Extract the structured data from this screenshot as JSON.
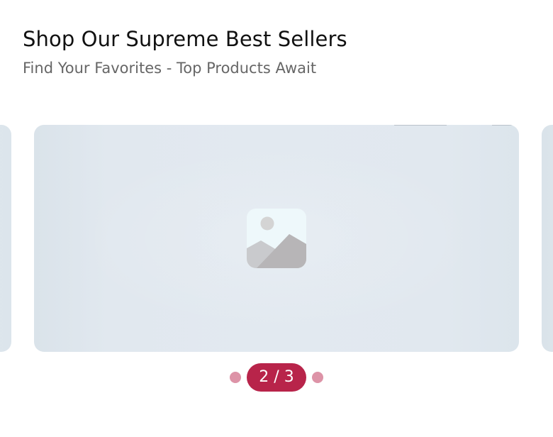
{
  "section": {
    "title": "Shop Our Supreme Best Sellers",
    "subtitle": "Find Your Favorites - Top Products Await"
  },
  "carousel": {
    "current_slide": 2,
    "total_slides": 3,
    "counter_text": "2 / 3",
    "icons": {
      "placeholder": "image-placeholder-icon"
    },
    "colors": {
      "accent": "#b8244a",
      "inactive_dot": "#dd93a7",
      "card_background": "#e1e8ef"
    }
  }
}
